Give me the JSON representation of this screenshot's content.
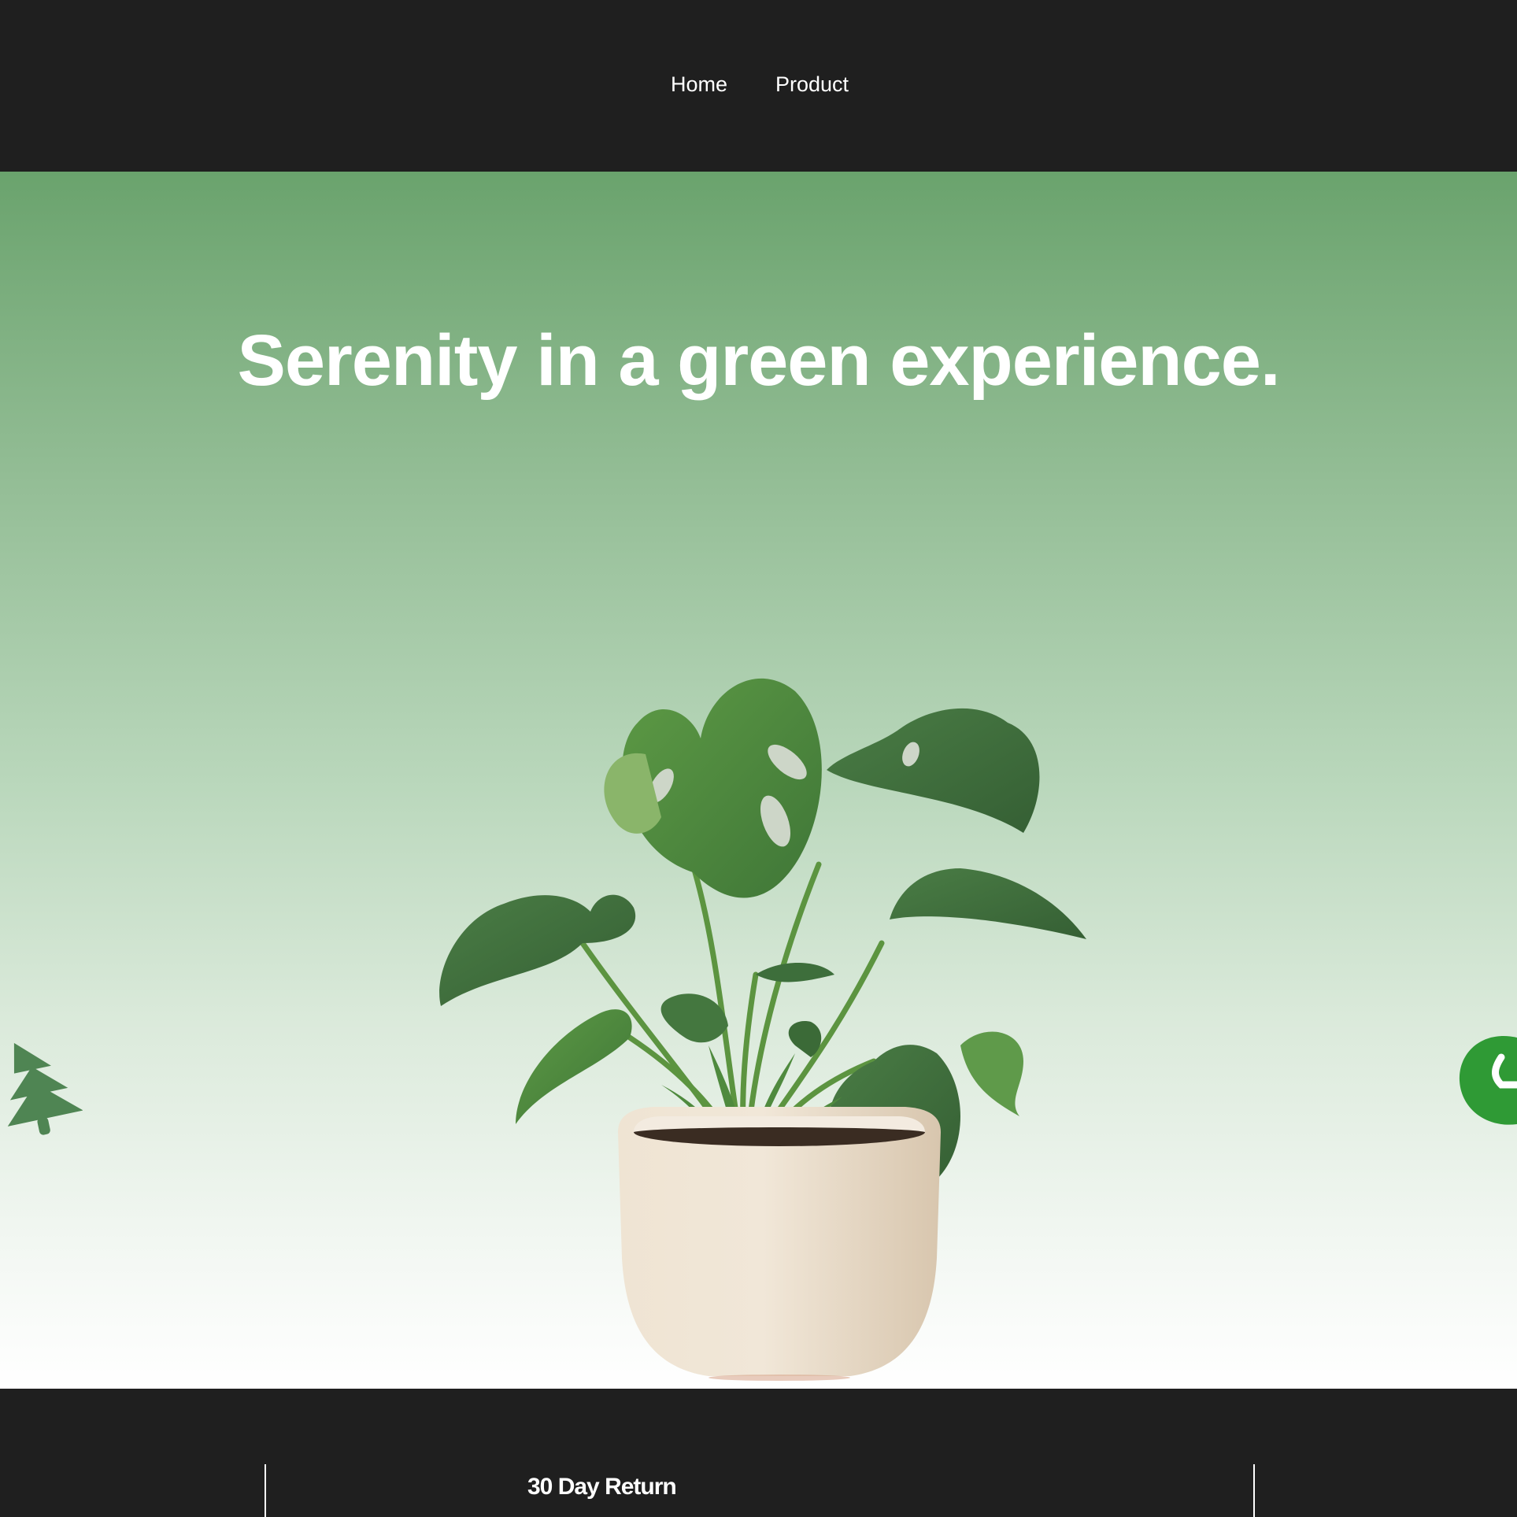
{
  "nav": {
    "links": [
      {
        "label": "Home"
      },
      {
        "label": "Product"
      }
    ]
  },
  "hero": {
    "title": "Serenity in a green experience.",
    "image_subject": "monstera-plant-in-beige-pot",
    "decor_icons": [
      "tree-icon",
      "leaf-icon"
    ]
  },
  "features": {
    "items": [
      {
        "title": "30 Day Return"
      }
    ]
  },
  "colors": {
    "nav_background": "#1f1f1f",
    "hero_gradient_top": "#6aa36d",
    "hero_gradient_bottom": "#ffffff",
    "text_light": "#ffffff",
    "tree_icon": "#4f8553",
    "leaf_icon": "#2f9a35"
  }
}
